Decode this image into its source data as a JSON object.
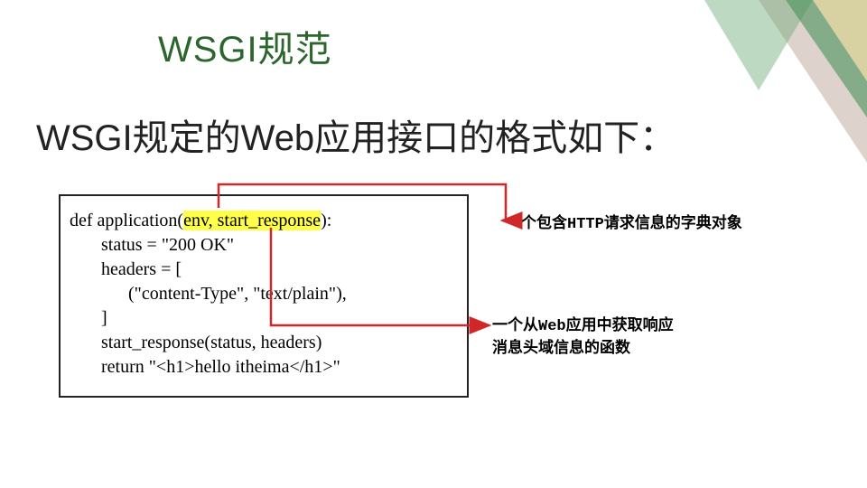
{
  "title": "WSGI规范",
  "subtitle": "WSGI规定的Web应用接口的格式如下：",
  "code": {
    "l1a": "def application(",
    "l1b": "env, start_response",
    "l1c": "):",
    "l2": "       status = \"200 OK\"",
    "l3": "       headers = [",
    "l4": "             (\"content-Type\", \"text/plain\"),",
    "l5": "       ]",
    "l6": "       start_response(status, headers)",
    "l7": "       return \"<h1>hello itheima</h1>\""
  },
  "annotations": {
    "env_label_a": "一个包含",
    "env_label_mono": "HTTP",
    "env_label_b": "请求信息的字典对象",
    "sr_label_a": "一个从",
    "sr_label_mono": "Web",
    "sr_label_b": "应用中获取响应",
    "sr_label_c": "消息头域信息的函数"
  },
  "colors": {
    "title_green": "#2c662d",
    "highlight": "#ffff4a",
    "arrow_red": "#d02828"
  }
}
